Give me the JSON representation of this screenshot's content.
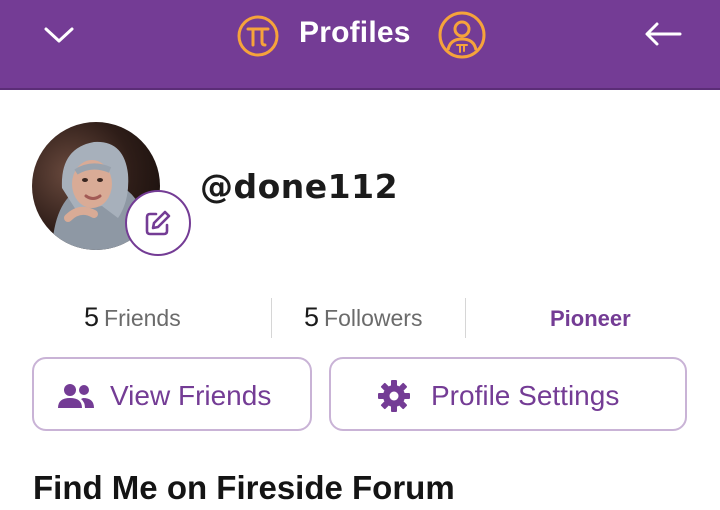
{
  "header": {
    "title": "Profiles",
    "left_icon": "chevron-down-icon",
    "logo_icon": "pi-logo-icon",
    "profile_icon": "pi-user-icon",
    "right_icon": "arrow-left-icon"
  },
  "profile": {
    "username": "@done112",
    "edit_icon": "edit-pencil-icon"
  },
  "stats": {
    "friends": {
      "count": "5",
      "label": "Friends"
    },
    "followers": {
      "count": "5",
      "label": "Followers"
    },
    "role": "Pioneer"
  },
  "actions": {
    "view_friends": {
      "label": "View Friends",
      "icon": "people-icon"
    },
    "profile_settings": {
      "label": "Profile Settings",
      "icon": "gear-icon"
    }
  },
  "section": {
    "title": "Find Me on Fireside Forum"
  },
  "colors": {
    "brand_purple": "#743c95",
    "pi_orange": "#f6a33b",
    "button_border": "#c9b3d6"
  }
}
